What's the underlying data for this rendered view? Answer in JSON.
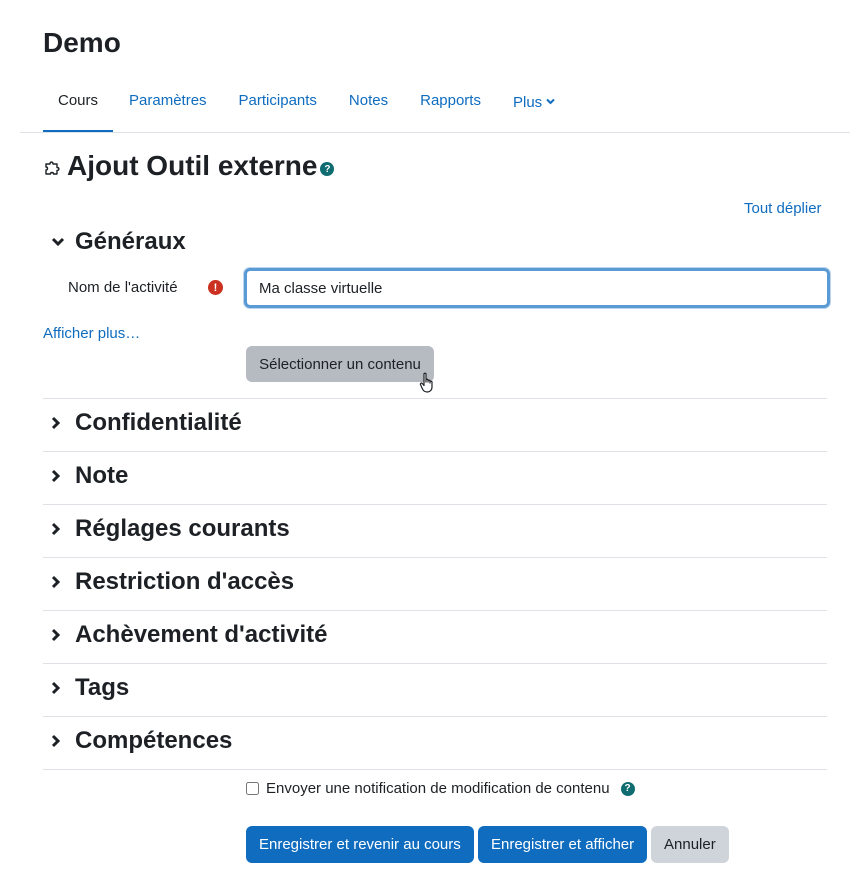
{
  "course": {
    "title": "Demo"
  },
  "nav": {
    "tabs": [
      {
        "label": "Cours"
      },
      {
        "label": "Paramètres"
      },
      {
        "label": "Participants"
      },
      {
        "label": "Notes"
      },
      {
        "label": "Rapports"
      },
      {
        "label": "Plus"
      }
    ]
  },
  "page": {
    "heading": "Ajout Outil externe",
    "help_glyph": "?"
  },
  "form": {
    "expand_all": "Tout déplier",
    "general": {
      "title": "Généraux",
      "name_label": "Nom de l'activité",
      "required_glyph": "!",
      "name_value": "Ma classe virtuelle",
      "show_more": "Afficher plus…",
      "select_content": "Sélectionner un contenu"
    },
    "sections": [
      {
        "title": "Confidentialité"
      },
      {
        "title": "Note"
      },
      {
        "title": "Réglages courants"
      },
      {
        "title": "Restriction d'accès"
      },
      {
        "title": "Achèvement d'activité"
      },
      {
        "title": "Tags"
      },
      {
        "title": "Compétences"
      }
    ],
    "notify": {
      "label": "Envoyer une notification de modification de contenu",
      "checked": false
    },
    "buttons": {
      "save_return": "Enregistrer et revenir au cours",
      "save_display": "Enregistrer et afficher",
      "cancel": "Annuler"
    }
  },
  "colors": {
    "link": "#0f6cbf",
    "primary": "#0f6cbf",
    "help": "#0f6c70",
    "required": "#ca3120",
    "secondary": "#ced4da",
    "text": "#1d2125"
  }
}
